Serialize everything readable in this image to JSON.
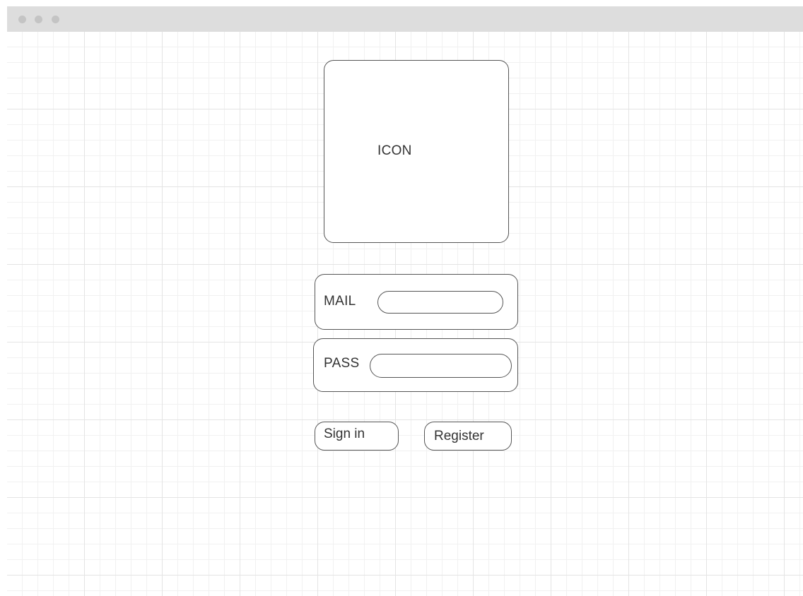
{
  "login": {
    "icon_label": "ICON",
    "mail_label": "MAIL",
    "mail_value": "",
    "pass_label": "PASS",
    "pass_value": "",
    "sign_in_label": "Sign in",
    "register_label": "Register"
  },
  "colors": {
    "titlebar": "#dddddd",
    "dots": "#c4c4c4",
    "border": "#555555",
    "grid_major": "#e4e4e4",
    "grid_minor": "#f1f1f1"
  }
}
